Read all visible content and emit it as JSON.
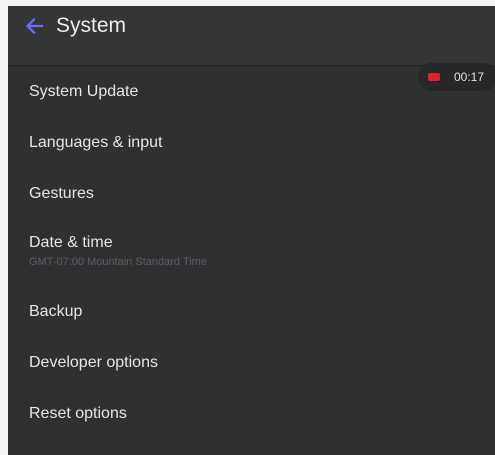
{
  "header": {
    "title": "System",
    "back_icon": "arrow-left-icon",
    "back_color": "#6c6cf5"
  },
  "items": [
    {
      "label": "System Update"
    },
    {
      "label": "Languages & input"
    },
    {
      "label": "Gestures"
    },
    {
      "label": "Date & time",
      "sub": "GMT-07:00 Mountain Standard Time"
    },
    {
      "label": "Backup"
    },
    {
      "label": "Developer options"
    },
    {
      "label": "Reset options"
    }
  ],
  "recorder": {
    "time": "00:17",
    "icon": "record-icon",
    "icon_color": "#e0202a"
  }
}
